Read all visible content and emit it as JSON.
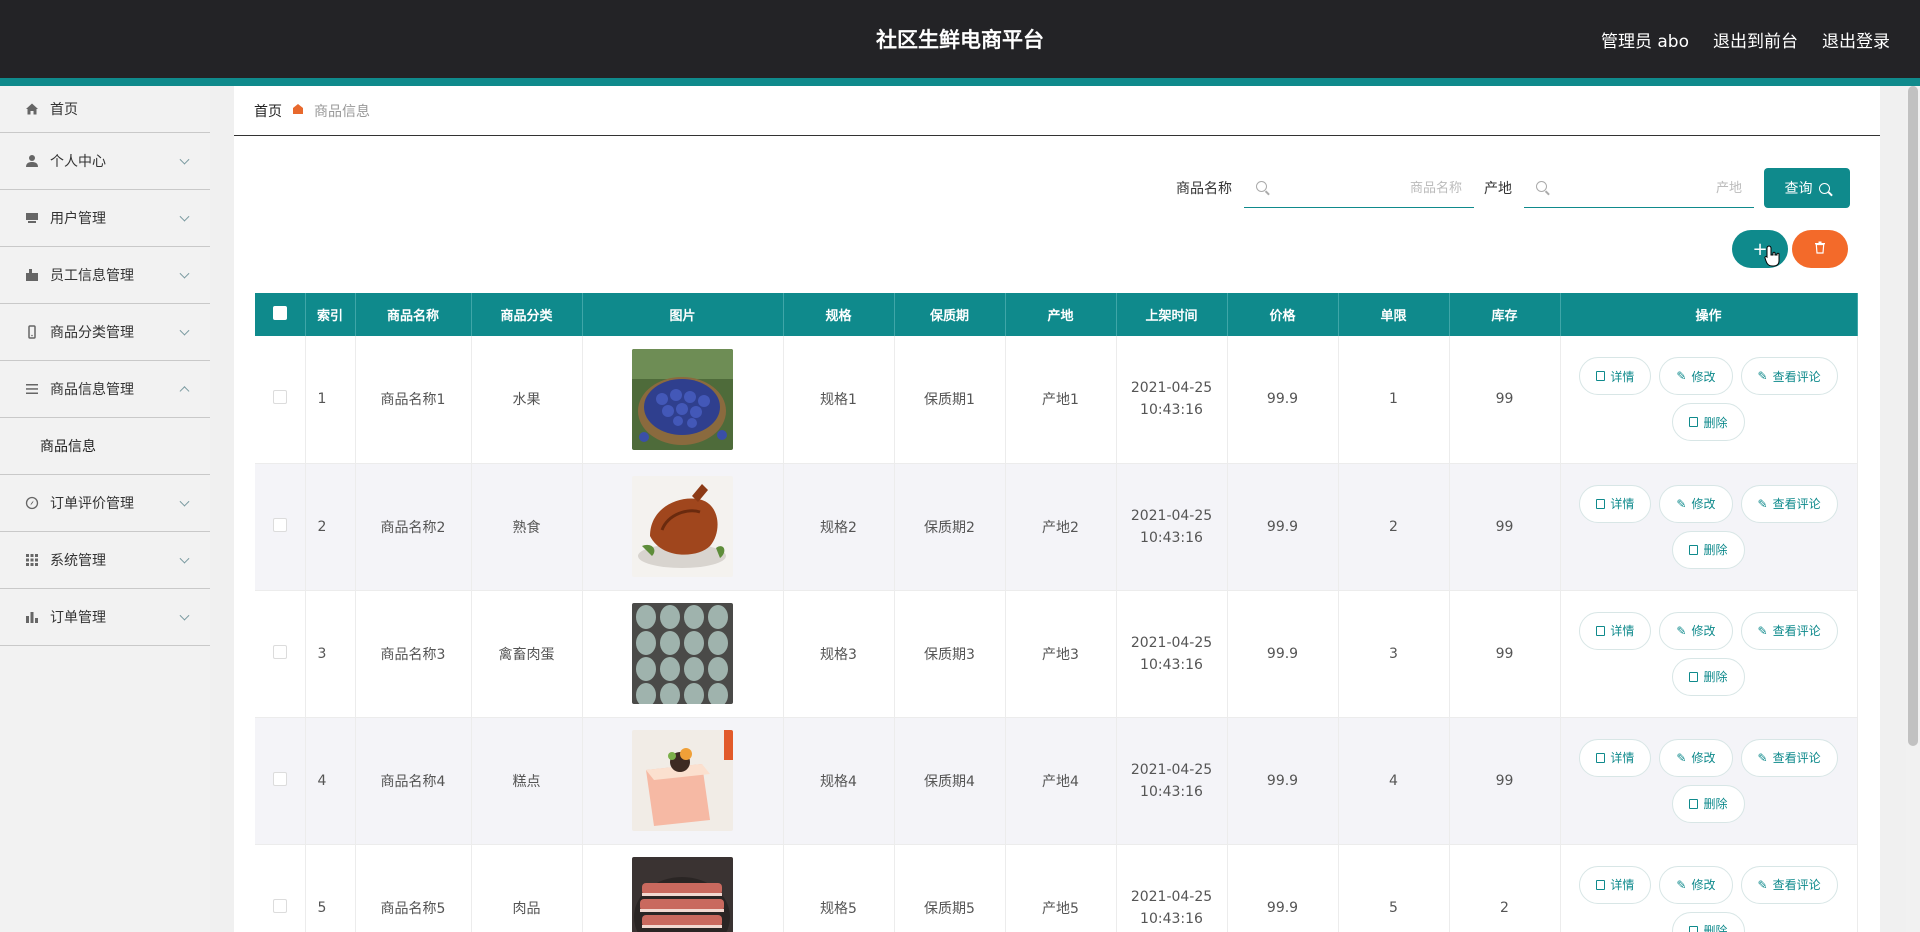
{
  "header": {
    "title": "社区生鲜电商平台",
    "admin_label": "管理员 abo",
    "exit_front": "退出到前台",
    "logout": "退出登录"
  },
  "sidebar": {
    "items": [
      {
        "label": "首页",
        "icon": "home-icon"
      },
      {
        "label": "个人中心",
        "icon": "user-icon"
      },
      {
        "label": "用户管理",
        "icon": "users-icon"
      },
      {
        "label": "员工信息管理",
        "icon": "staff-icon"
      },
      {
        "label": "商品分类管理",
        "icon": "category-icon"
      },
      {
        "label": "商品信息管理",
        "icon": "list-icon",
        "expanded": true
      },
      {
        "label": "商品信息",
        "sub": true
      },
      {
        "label": "订单评价管理",
        "icon": "compass-icon"
      },
      {
        "label": "系统管理",
        "icon": "grid-icon"
      },
      {
        "label": "订单管理",
        "icon": "bar-chart-icon"
      }
    ]
  },
  "breadcrumb": {
    "home": "首页",
    "current": "商品信息"
  },
  "search": {
    "name_label": "商品名称",
    "name_placeholder": "商品名称",
    "origin_label": "产地",
    "origin_placeholder": "产地",
    "query_button": "查询"
  },
  "actions": {
    "add": "+",
    "delete_icon": "trash-icon"
  },
  "table": {
    "columns": [
      "索引",
      "商品名称",
      "商品分类",
      "图片",
      "规格",
      "保质期",
      "产地",
      "上架时间",
      "价格",
      "单限",
      "库存",
      "操作"
    ],
    "rows": [
      {
        "index": "1",
        "name": "商品名称1",
        "category": "水果",
        "image": "blueberries",
        "spec": "规格1",
        "shelf": "保质期1",
        "origin": "产地1",
        "date": "2021-04-25",
        "time": "10:43:16",
        "price": "99.9",
        "limit": "1",
        "stock": "99"
      },
      {
        "index": "2",
        "name": "商品名称2",
        "category": "熟食",
        "image": "roast-duck",
        "spec": "规格2",
        "shelf": "保质期2",
        "origin": "产地2",
        "date": "2021-04-25",
        "time": "10:43:16",
        "price": "99.9",
        "limit": "2",
        "stock": "99"
      },
      {
        "index": "3",
        "name": "商品名称3",
        "category": "禽畜肉蛋",
        "image": "eggs",
        "spec": "规格3",
        "shelf": "保质期3",
        "origin": "产地3",
        "date": "2021-04-25",
        "time": "10:43:16",
        "price": "99.9",
        "limit": "3",
        "stock": "99"
      },
      {
        "index": "4",
        "name": "商品名称4",
        "category": "糕点",
        "image": "cake",
        "spec": "规格4",
        "shelf": "保质期4",
        "origin": "产地4",
        "date": "2021-04-25",
        "time": "10:43:16",
        "price": "99.9",
        "limit": "4",
        "stock": "99"
      },
      {
        "index": "5",
        "name": "商品名称5",
        "category": "肉品",
        "image": "meat",
        "spec": "规格5",
        "shelf": "保质期5",
        "origin": "产地5",
        "date": "2021-04-25",
        "time": "10:43:16",
        "price": "99.9",
        "limit": "5",
        "stock": "2"
      }
    ],
    "ops": {
      "detail": "详情",
      "edit": "修改",
      "comments": "查看评论",
      "delete": "删除"
    }
  },
  "colors": {
    "accent": "#0f8a8c",
    "danger": "#f36a2a",
    "header_bg": "#232326"
  }
}
